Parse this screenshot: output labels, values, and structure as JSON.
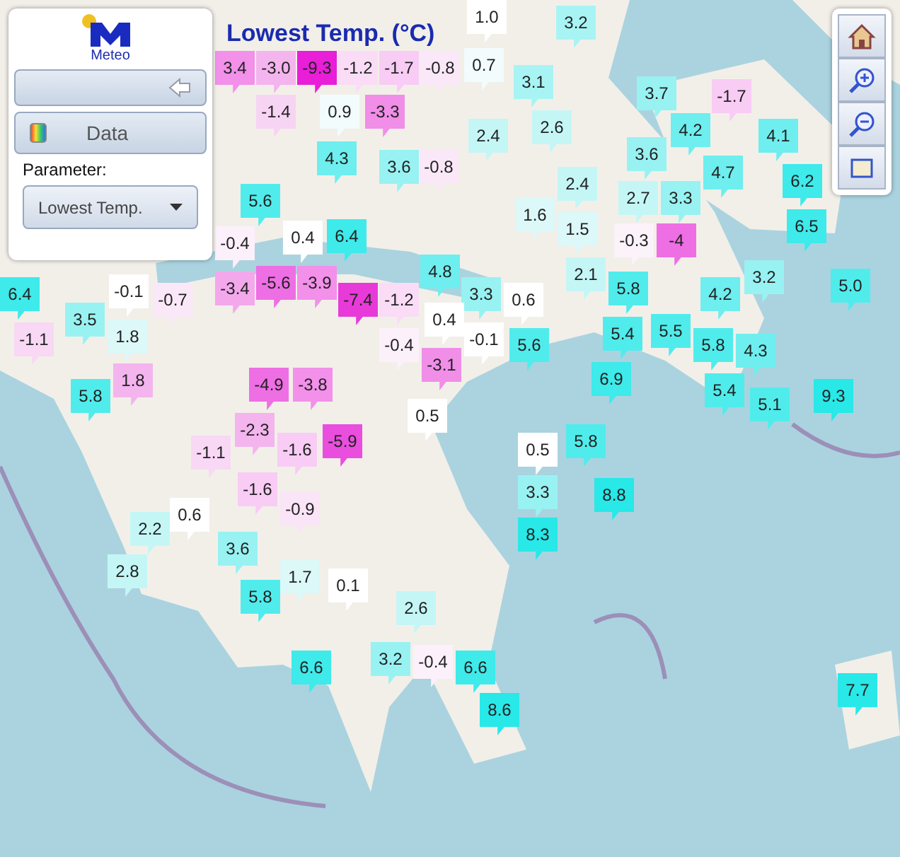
{
  "panel": {
    "logo_text": "Meteo",
    "data_button": "Data",
    "parameter_label": "Parameter:",
    "parameter_select": "Lowest Temp."
  },
  "map_title": "Lowest Temp. (°C)",
  "markers": [
    {
      "value": "1.0",
      "color": "#ffffff"
    },
    {
      "value": "3.2",
      "color": "#a8f4f4"
    },
    {
      "value": "3.4",
      "color": "#f290ea"
    },
    {
      "value": "-3.0",
      "color": "#f4b4ee"
    },
    {
      "value": "-9.3",
      "color": "#e81ed8"
    },
    {
      "value": "-1.2",
      "color": "#fadcf6"
    },
    {
      "value": "-1.7",
      "color": "#f8ccf4"
    },
    {
      "value": "-0.8",
      "color": "#fae8f8"
    },
    {
      "value": "0.7",
      "color": "#f2fcfc"
    },
    {
      "value": "3.1",
      "color": "#a8f4f4"
    },
    {
      "value": "-1.4",
      "color": "#f8d4f4"
    },
    {
      "value": "0.9",
      "color": "#f2fcfc"
    },
    {
      "value": "-3.3",
      "color": "#f08ee8"
    },
    {
      "value": "2.4",
      "color": "#c4f6f6"
    },
    {
      "value": "2.6",
      "color": "#c4f6f6"
    },
    {
      "value": "3.7",
      "color": "#98f2f2"
    },
    {
      "value": "-1.7",
      "color": "#f8ccf4"
    },
    {
      "value": "4.2",
      "color": "#6eeeee"
    },
    {
      "value": "3.6",
      "color": "#98f2f2"
    },
    {
      "value": "4.1",
      "color": "#6eeeee"
    },
    {
      "value": "6.2",
      "color": "#3eeaea"
    },
    {
      "value": "6.5",
      "color": "#3eeaea"
    },
    {
      "value": "4.3",
      "color": "#6eeeee"
    },
    {
      "value": "3.6",
      "color": "#98f2f2"
    },
    {
      "value": "-0.8",
      "color": "#fae8f8"
    },
    {
      "value": "2.4",
      "color": "#c4f6f6"
    },
    {
      "value": "1.6",
      "color": "#dcf8f8"
    },
    {
      "value": "2.7",
      "color": "#c4f6f6"
    },
    {
      "value": "4.7",
      "color": "#6eeeee"
    },
    {
      "value": "3.3",
      "color": "#98f2f2"
    },
    {
      "value": "1.5",
      "color": "#dcf8f8"
    },
    {
      "value": "-0.3",
      "color": "#fcf2fa"
    },
    {
      "value": "-4",
      "color": "#ee6ee4"
    },
    {
      "value": "5.6",
      "color": "#50ecec"
    },
    {
      "value": "-0.4",
      "color": "#fcf0fa"
    },
    {
      "value": "0.4",
      "color": "#ffffff"
    },
    {
      "value": "6.4",
      "color": "#3eeaea"
    },
    {
      "value": "2.1",
      "color": "#c4f6f6"
    },
    {
      "value": "5.8",
      "color": "#50ecec"
    },
    {
      "value": "6.4",
      "color": "#3eeaea"
    },
    {
      "value": "-0.1",
      "color": "#ffffff"
    },
    {
      "value": "-0.7",
      "color": "#fae8f8"
    },
    {
      "value": "3.5",
      "color": "#98f2f2"
    },
    {
      "value": "-1.1",
      "color": "#f8d8f4"
    },
    {
      "value": "1.8",
      "color": "#dcf8f8"
    },
    {
      "value": "1.8",
      "color": "#f4b4ee"
    },
    {
      "value": "5.8",
      "color": "#50ecec"
    },
    {
      "value": "-3.4",
      "color": "#f4a8ec"
    },
    {
      "value": "-5.6",
      "color": "#ee6ee4"
    },
    {
      "value": "-3.9",
      "color": "#f290ea"
    },
    {
      "value": "-7.4",
      "color": "#e83ad8"
    },
    {
      "value": "-1.2",
      "color": "#fadcf6"
    },
    {
      "value": "4.8",
      "color": "#6eeeee"
    },
    {
      "value": "3.3",
      "color": "#98f2f2"
    },
    {
      "value": "0.4",
      "color": "#ffffff"
    },
    {
      "value": "0.6",
      "color": "#ffffff"
    },
    {
      "value": "-0.1",
      "color": "#ffffff"
    },
    {
      "value": "-0.4",
      "color": "#fcf0fa"
    },
    {
      "value": "-3.1",
      "color": "#f08ee8"
    },
    {
      "value": "5.6",
      "color": "#50ecec"
    },
    {
      "value": "5.4",
      "color": "#50ecec"
    },
    {
      "value": "5.5",
      "color": "#50ecec"
    },
    {
      "value": "4.2",
      "color": "#6eeeee"
    },
    {
      "value": "3.2",
      "color": "#98f2f2"
    },
    {
      "value": "5.0",
      "color": "#50ecec"
    },
    {
      "value": "5.8",
      "color": "#50ecec"
    },
    {
      "value": "4.3",
      "color": "#6eeeee"
    },
    {
      "value": "5.4",
      "color": "#50ecec"
    },
    {
      "value": "6.9",
      "color": "#3eeaea"
    },
    {
      "value": "5.1",
      "color": "#50ecec"
    },
    {
      "value": "9.3",
      "color": "#28e8e8"
    },
    {
      "value": "-4.9",
      "color": "#ee6ee4"
    },
    {
      "value": "-3.8",
      "color": "#f290ea"
    },
    {
      "value": "-2.3",
      "color": "#f4b4ee"
    },
    {
      "value": "-1.1",
      "color": "#f8d8f4"
    },
    {
      "value": "-1.6",
      "color": "#f8ccf4"
    },
    {
      "value": "-5.9",
      "color": "#ea4ede"
    },
    {
      "value": "0.5",
      "color": "#ffffff"
    },
    {
      "value": "-1.6",
      "color": "#f8ccf4"
    },
    {
      "value": "-0.9",
      "color": "#fae4f8"
    },
    {
      "value": "5.8",
      "color": "#50ecec"
    },
    {
      "value": "0.5",
      "color": "#ffffff"
    },
    {
      "value": "3.3",
      "color": "#98f2f2"
    },
    {
      "value": "8.8",
      "color": "#28e8e8"
    },
    {
      "value": "8.3",
      "color": "#28e8e8"
    },
    {
      "value": "0.6",
      "color": "#ffffff"
    },
    {
      "value": "2.2",
      "color": "#c4f6f6"
    },
    {
      "value": "2.8",
      "color": "#c4f6f6"
    },
    {
      "value": "3.6",
      "color": "#98f2f2"
    },
    {
      "value": "1.7",
      "color": "#dcf8f8"
    },
    {
      "value": "0.1",
      "color": "#ffffff"
    },
    {
      "value": "5.8",
      "color": "#50ecec"
    },
    {
      "value": "2.6",
      "color": "#c4f6f6"
    },
    {
      "value": "6.6",
      "color": "#3eeaea"
    },
    {
      "value": "3.2",
      "color": "#98f2f2"
    },
    {
      "value": "-0.4",
      "color": "#fcf0fa"
    },
    {
      "value": "6.6",
      "color": "#3eeaea"
    },
    {
      "value": "8.6",
      "color": "#28e8e8"
    },
    {
      "value": "7.7",
      "color": "#28e8e8"
    }
  ]
}
